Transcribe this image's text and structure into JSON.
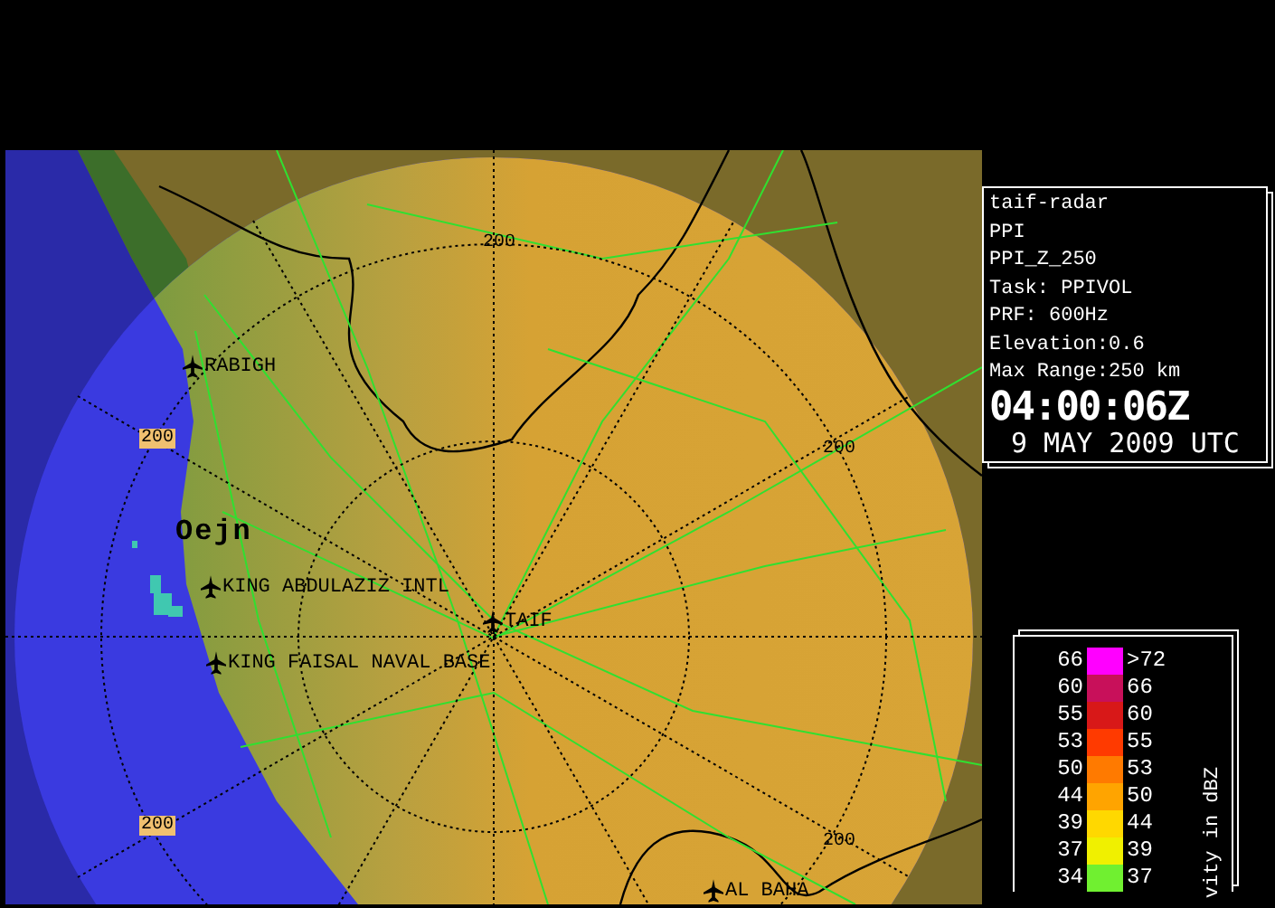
{
  "map": {
    "range_labels": [
      {
        "text": "200",
        "kind": "boxed"
      },
      {
        "text": "200",
        "kind": "plain"
      },
      {
        "text": "200",
        "kind": "plain"
      },
      {
        "text": "200",
        "kind": "boxed"
      },
      {
        "text": "200",
        "kind": "plain"
      }
    ],
    "places": [
      {
        "text": "RABIGH",
        "kind": "airport"
      },
      {
        "text": "Oejn",
        "kind": "site"
      },
      {
        "text": "KING ABDULAZIZ INTL",
        "kind": "airport"
      },
      {
        "text": "TAIF",
        "kind": "airport"
      },
      {
        "text": "KING FAISAL NAVAL BASE",
        "kind": "airport"
      },
      {
        "text": "AL BAHA",
        "kind": "airport"
      }
    ]
  },
  "info": {
    "lines": [
      "taif-radar",
      "PPI",
      "PPI_Z_250",
      "Task: PPIVOL",
      "PRF: 600Hz",
      "Elevation:0.6",
      "Max Range:250 km"
    ],
    "time": "04:00:06Z",
    "date": "9 MAY 2009 UTC"
  },
  "legend": {
    "title": "vity in dBZ",
    "rows": [
      {
        "low": "66",
        "high": ">72",
        "color": "#ff00ff"
      },
      {
        "low": "60",
        "high": "66",
        "color": "#c8105a"
      },
      {
        "low": "55",
        "high": "60",
        "color": "#d81818"
      },
      {
        "low": "53",
        "high": "55",
        "color": "#ff3a00"
      },
      {
        "low": "50",
        "high": "53",
        "color": "#ff7a00"
      },
      {
        "low": "44",
        "high": "50",
        "color": "#ffa400"
      },
      {
        "low": "39",
        "high": "44",
        "color": "#ffd800"
      },
      {
        "low": "37",
        "high": "39",
        "color": "#f0f000"
      },
      {
        "low": "34",
        "high": "37",
        "color": "#70f030"
      }
    ]
  }
}
